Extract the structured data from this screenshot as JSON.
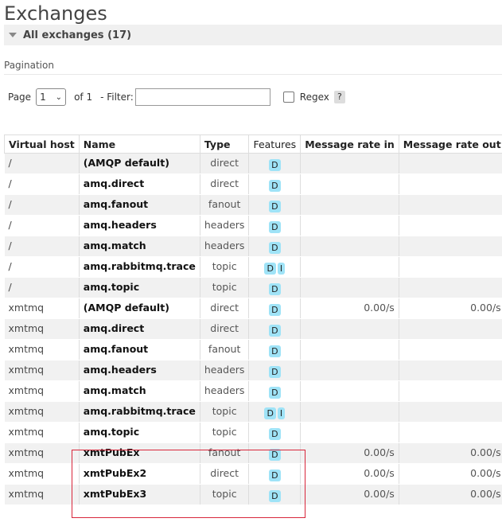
{
  "page": {
    "title": "Exchanges"
  },
  "section": {
    "label": "All exchanges (17)"
  },
  "pagination": {
    "label": "Pagination",
    "page_label": "Page",
    "page_value": "1",
    "of_label": "of 1",
    "filter_label": "- Filter:",
    "filter_value": "",
    "regex_label": "Regex",
    "help_label": "?"
  },
  "table": {
    "headers": [
      "Virtual host",
      "Name",
      "Type",
      "Features",
      "Message rate in",
      "Message rate out"
    ],
    "rows": [
      {
        "vhost": "/",
        "name": "(AMQP default)",
        "type": "direct",
        "features": [
          "D"
        ],
        "rate_in": "",
        "rate_out": ""
      },
      {
        "vhost": "/",
        "name": "amq.direct",
        "type": "direct",
        "features": [
          "D"
        ],
        "rate_in": "",
        "rate_out": ""
      },
      {
        "vhost": "/",
        "name": "amq.fanout",
        "type": "fanout",
        "features": [
          "D"
        ],
        "rate_in": "",
        "rate_out": ""
      },
      {
        "vhost": "/",
        "name": "amq.headers",
        "type": "headers",
        "features": [
          "D"
        ],
        "rate_in": "",
        "rate_out": ""
      },
      {
        "vhost": "/",
        "name": "amq.match",
        "type": "headers",
        "features": [
          "D"
        ],
        "rate_in": "",
        "rate_out": ""
      },
      {
        "vhost": "/",
        "name": "amq.rabbitmq.trace",
        "type": "topic",
        "features": [
          "D",
          "I"
        ],
        "rate_in": "",
        "rate_out": ""
      },
      {
        "vhost": "/",
        "name": "amq.topic",
        "type": "topic",
        "features": [
          "D"
        ],
        "rate_in": "",
        "rate_out": ""
      },
      {
        "vhost": "xmtmq",
        "name": "(AMQP default)",
        "type": "direct",
        "features": [
          "D"
        ],
        "rate_in": "0.00/s",
        "rate_out": "0.00/s"
      },
      {
        "vhost": "xmtmq",
        "name": "amq.direct",
        "type": "direct",
        "features": [
          "D"
        ],
        "rate_in": "",
        "rate_out": ""
      },
      {
        "vhost": "xmtmq",
        "name": "amq.fanout",
        "type": "fanout",
        "features": [
          "D"
        ],
        "rate_in": "",
        "rate_out": ""
      },
      {
        "vhost": "xmtmq",
        "name": "amq.headers",
        "type": "headers",
        "features": [
          "D"
        ],
        "rate_in": "",
        "rate_out": ""
      },
      {
        "vhost": "xmtmq",
        "name": "amq.match",
        "type": "headers",
        "features": [
          "D"
        ],
        "rate_in": "",
        "rate_out": ""
      },
      {
        "vhost": "xmtmq",
        "name": "amq.rabbitmq.trace",
        "type": "topic",
        "features": [
          "D",
          "I"
        ],
        "rate_in": "",
        "rate_out": ""
      },
      {
        "vhost": "xmtmq",
        "name": "amq.topic",
        "type": "topic",
        "features": [
          "D"
        ],
        "rate_in": "",
        "rate_out": ""
      },
      {
        "vhost": "xmtmq",
        "name": "xmtPubEx",
        "type": "fanout",
        "features": [
          "D"
        ],
        "rate_in": "0.00/s",
        "rate_out": "0.00/s"
      },
      {
        "vhost": "xmtmq",
        "name": "xmtPubEx2",
        "type": "direct",
        "features": [
          "D"
        ],
        "rate_in": "0.00/s",
        "rate_out": "0.00/s"
      },
      {
        "vhost": "xmtmq",
        "name": "xmtPubEx3",
        "type": "topic",
        "features": [
          "D"
        ],
        "rate_in": "0.00/s",
        "rate_out": "0.00/s"
      }
    ]
  },
  "colors": {
    "badge": "#9fe3f7",
    "highlight": "#d8263b",
    "row_alt": "#f1f1f1"
  }
}
